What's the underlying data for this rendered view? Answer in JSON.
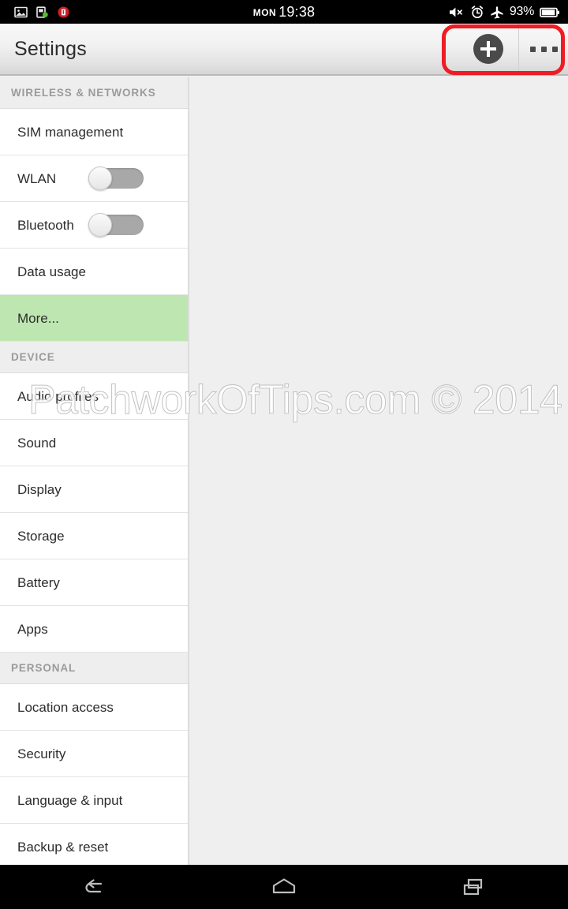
{
  "status_bar": {
    "left_icons": [
      {
        "name": "screenshot-icon",
        "label": "screenshot"
      },
      {
        "name": "sim-contact-icon",
        "label": "sim-card"
      },
      {
        "name": "app-notification-icon",
        "label": "notification"
      }
    ],
    "day": "MON",
    "time": "19:38",
    "right_icons": [
      {
        "name": "mute-icon",
        "label": "volume-mute"
      },
      {
        "name": "alarm-icon",
        "label": "alarm-set"
      },
      {
        "name": "airplane-mode-icon",
        "label": "airplane-mode"
      }
    ],
    "battery_percent": "93%"
  },
  "action_bar": {
    "title": "Settings",
    "add_label": "add-icon",
    "overflow_label": "more-options-icon"
  },
  "sidebar": {
    "sections": [
      {
        "header": "WIRELESS & NETWORKS",
        "items": [
          {
            "label": "SIM management",
            "type": "plain",
            "selected": false
          },
          {
            "label": "WLAN",
            "type": "switch",
            "switch_on": false,
            "selected": false
          },
          {
            "label": "Bluetooth",
            "type": "switch",
            "switch_on": false,
            "selected": false
          },
          {
            "label": "Data usage",
            "type": "plain",
            "selected": false
          },
          {
            "label": "More...",
            "type": "plain",
            "selected": true
          }
        ]
      },
      {
        "header": "DEVICE",
        "items": [
          {
            "label": "Audio profiles",
            "type": "plain",
            "selected": false
          },
          {
            "label": "Sound",
            "type": "plain",
            "selected": false
          },
          {
            "label": "Display",
            "type": "plain",
            "selected": false
          },
          {
            "label": "Storage",
            "type": "plain",
            "selected": false
          },
          {
            "label": "Battery",
            "type": "plain",
            "selected": false
          },
          {
            "label": "Apps",
            "type": "plain",
            "selected": false
          }
        ]
      },
      {
        "header": "PERSONAL",
        "items": [
          {
            "label": "Location access",
            "type": "plain",
            "selected": false
          },
          {
            "label": "Security",
            "type": "plain",
            "selected": false
          },
          {
            "label": "Language & input",
            "type": "plain",
            "selected": false
          },
          {
            "label": "Backup & reset",
            "type": "plain",
            "selected": false
          }
        ]
      }
    ]
  },
  "watermark": {
    "text": "PatchworkOfTips.com © 2014"
  },
  "navigation_bar": {
    "back": "back-icon",
    "home": "home-icon",
    "recents": "recent-apps-icon"
  },
  "colors": {
    "selected_item": "#bee6b1",
    "annotation": "#ee1c24",
    "content_bg": "#efefef",
    "action_bar_bg": "#e6e6e6",
    "section_header_text": "#9a9a9a"
  }
}
